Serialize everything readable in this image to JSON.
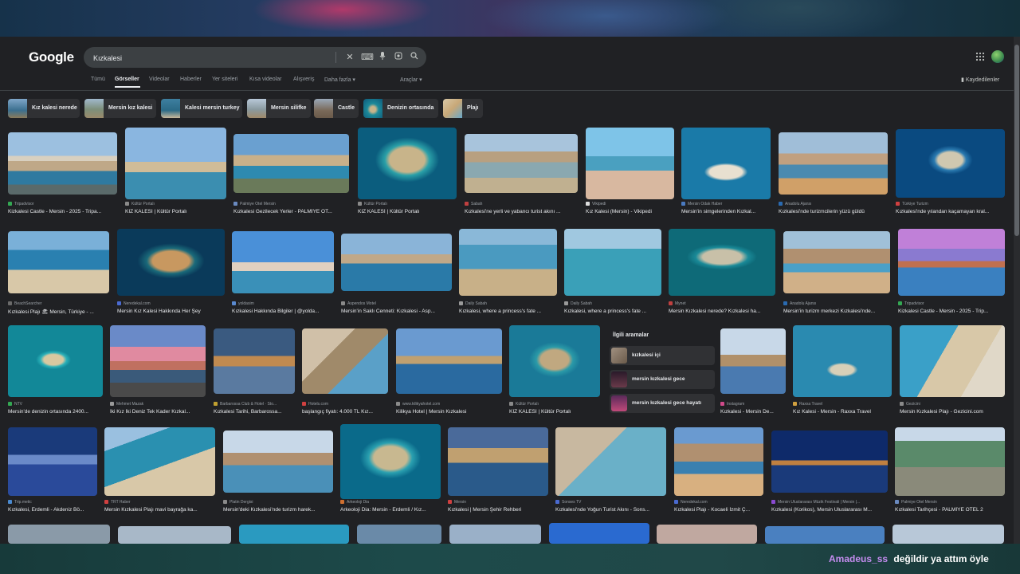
{
  "header": {
    "logo": "Google",
    "search_value": "Kızkalesi",
    "saved_label": "Kaydedilenler"
  },
  "tabs": [
    "Tümü",
    "Görseller",
    "Videolar",
    "Haberler",
    "Yer siteleri",
    "Kısa videolar",
    "Alışveriş",
    "Daha fazla"
  ],
  "tools_label": "Araçlar",
  "chips": [
    {
      "label": "Kız kalesi nerede"
    },
    {
      "label": "Mersin kız kalesi"
    },
    {
      "label": "Kalesi mersin turkey"
    },
    {
      "label": "Mersin silifke"
    },
    {
      "label": "Castle"
    },
    {
      "label": "Denizin ortasında"
    },
    {
      "label": "Plajı"
    }
  ],
  "related": {
    "heading": "İlgili aramalar",
    "items": [
      "kızkalesi içi",
      "mersin kızkalesi gece",
      "mersin kızkalesi gece hayatı"
    ]
  },
  "results": [
    {
      "source": "Tripadvisor",
      "title": "Kizkalesi Castle - Mersin - 2025 - Tripa..."
    },
    {
      "source": "Kültür Portalı",
      "title": "KIZ KALESİ | Kültür Portalı"
    },
    {
      "source": "Palmiye Otel Mersin",
      "title": "Kızkalesi Gezilecek Yerler - PALMİYE OT..."
    },
    {
      "source": "Kültür Portalı",
      "title": "KIZ KALESİ | Kültür Portalı"
    },
    {
      "source": "Sabah",
      "title": "Kızkalesi'ne yerli ve yabancı turist akını ..."
    },
    {
      "source": "Vikipedi",
      "title": "Kız Kalesi (Mersin) - Vikipedi"
    },
    {
      "source": "Mersin Odak Haber",
      "title": "Mersin'in simgelerinden Kızkal..."
    },
    {
      "source": "Anadolu Ajansı",
      "title": "Kızkalesi'nde turizmcilerin yüzü güldü"
    },
    {
      "source": "Türkiye Turizm",
      "title": "Kızkalesi'nde yılandan kaçamayan kral..."
    },
    {
      "source": "BeachSearcher",
      "title": "Kızkalesi Plajı 🏖 Mersin, Türkiye - ..."
    },
    {
      "source": "Neredekal.com",
      "title": "Mersin Kız Kalesi Hakkında Her Şey"
    },
    {
      "source": "yoldasim",
      "title": "Kızkalesi Hakkında Bilgiler | @yolda..."
    },
    {
      "source": "Aspendos Motel",
      "title": "Mersin'in Saklı Cenneti: Kızkalesi - Asp..."
    },
    {
      "source": "Daily Sabah",
      "title": "Kızkalesi, where a princess's fate ..."
    },
    {
      "source": "Daily Sabah",
      "title": "Kızkalesi, where a princess's fate ..."
    },
    {
      "source": "Mynet",
      "title": "Mersin Kızkalesi nerede? Kızkalesi ha..."
    },
    {
      "source": "Anadolu Ajansı",
      "title": "Mersin'in turizm merkezi Kızkalesi'nde..."
    },
    {
      "source": "Tripadvisor",
      "title": "Kizkalesi Castle - Mersin - 2025 - Trip..."
    },
    {
      "source": "NTV",
      "title": "Mersin'de denizin ortasında 2400..."
    },
    {
      "source": "Mehmet Mazak",
      "title": "İki Kız İki Deniz Tek Kader Kızkal..."
    },
    {
      "source": "Barbarossa Club & Hotel · Sto...",
      "title": "Kızkalesi Tarihi, Barbarossa..."
    },
    {
      "source": "Hotels.com",
      "title": "başlangıç fiyatı: 4.000 TL Kız..."
    },
    {
      "source": "www.kilikyahotel.com",
      "title": "Kilikya Hotel | Mersin Kızkalesi"
    },
    {
      "source": "Kültür Portalı",
      "title": "KIZ KALESİ | Kültür Portalı"
    },
    {
      "source": "Instagram",
      "title": "Kızkalesi - Mersin De..."
    },
    {
      "source": "Raxxa Travel",
      "title": "Kız Kalesi - Mersin - Raxxa Travel"
    },
    {
      "source": "Gezicini",
      "title": "Mersin Kızkalesi Plajı - Gezicini.com"
    },
    {
      "source": "Trip.metic",
      "title": "Kızkalesi, Erdemli - Akdeniz Bö..."
    },
    {
      "source": "TRT Haber",
      "title": "Mersin Kızkalesi Plajı mavi bayrağa ka..."
    },
    {
      "source": "Platin Dergisi",
      "title": "Mersin'deki Kızkalesi'nde turizm harek..."
    },
    {
      "source": "Arkeoloji Dia",
      "title": "Arkeoloji Dia: Mersin - Erdemli / Kız..."
    },
    {
      "source": "Mersin",
      "title": "Kızkalesi | Mersin Şehir Rehberi"
    },
    {
      "source": "Sonses TV",
      "title": "Kızkalesi'nde Yoğun Turist Akını - Sons..."
    },
    {
      "source": "Neredekal.com",
      "title": "Kızkalesi Plajı - Kocaeli İzmit Ç..."
    },
    {
      "source": "Mersin Uluslararası Müzik Festivali | Mersin |...",
      "title": "Kızkalesi (Korikos), Mersin Uluslararası M..."
    },
    {
      "source": "Palmiye Otel Mersin",
      "title": "Kızkalesi Tarihçesi - PALMİYE OTEL 2"
    }
  ],
  "chat": {
    "username": "Amadeus_ss",
    "message": "değildir ya attım öyle"
  },
  "colors": {
    "page_bg": "#202124",
    "chip_bg": "#303134",
    "text": "#e8eaed",
    "muted": "#9aa0a6",
    "chat_user": "#c58cf0"
  },
  "icons": [
    "clear-icon",
    "keyboard-icon",
    "mic-icon",
    "lens-icon",
    "search-icon",
    "apps-grid-icon",
    "bookmark-icon",
    "caret-down-icon"
  ]
}
